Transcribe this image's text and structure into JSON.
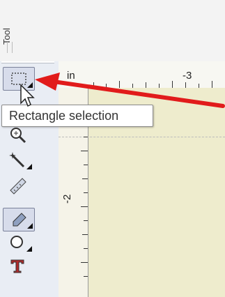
{
  "toolbox": {
    "title": "Tool "
  },
  "rulers": {
    "unit": "in",
    "top_label": "-3",
    "left_label": "-2"
  },
  "tooltip": {
    "text": "Rectangle selection"
  },
  "tools": [
    {
      "name": "rectangle-selection",
      "icon": "rectangle-selection-icon"
    },
    {
      "name": "zoom",
      "icon": "zoom-icon"
    },
    {
      "name": "magic-wand",
      "icon": "magic-wand-icon"
    },
    {
      "name": "measure",
      "icon": "ruler-icon"
    },
    {
      "name": "eyedropper",
      "icon": "eyedropper-icon"
    },
    {
      "name": "ellipse",
      "icon": "ellipse-icon"
    },
    {
      "name": "text",
      "icon": "text-icon"
    }
  ],
  "colors": {
    "arrow": "#e11b1b",
    "canvas": "#eeeccd",
    "tool_panel": "#e9edf4"
  }
}
